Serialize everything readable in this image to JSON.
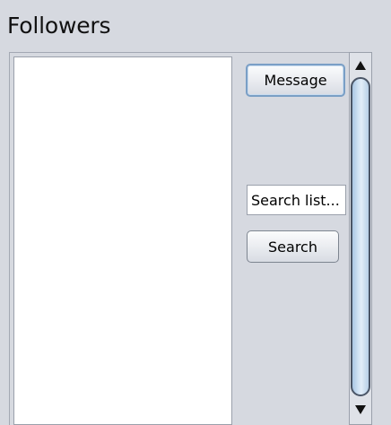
{
  "header": {
    "title": "Followers"
  },
  "followers_list": {
    "items": []
  },
  "actions": {
    "message_label": "Message",
    "search_placeholder": "Search list...",
    "search_value": "Search list...",
    "search_label": "Search"
  },
  "scrollbar": {
    "up_icon": "triangle-up-icon",
    "down_icon": "triangle-down-icon"
  },
  "colors": {
    "background": "#d6d9e0",
    "focus_border": "#7a9fc6",
    "thumb": "#b7cfe7"
  }
}
